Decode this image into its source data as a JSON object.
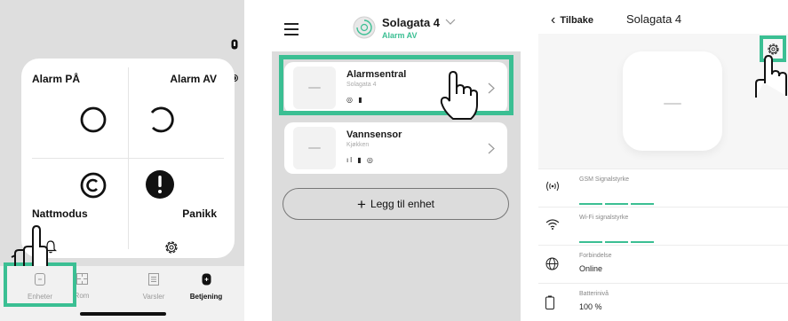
{
  "panel1": {
    "alarm_on": "Alarm PÅ",
    "alarm_off": "Alarm AV",
    "night_mode": "Nattmodus",
    "panic": "Panikk",
    "tabs": [
      {
        "label": "Enheter",
        "icon": "devices-icon"
      },
      {
        "label": "Rom",
        "icon": "rooms-icon"
      },
      {
        "label": "Varsler",
        "icon": "notifications-icon"
      },
      {
        "label": "Betjening",
        "icon": "control-icon"
      }
    ],
    "active_tab": "Betjening"
  },
  "panel2": {
    "hub_name": "Solagata 4",
    "hub_status": "Alarm AV",
    "devices": [
      {
        "name": "Alarmsentral",
        "room": "Solagata 4",
        "status_icons": "◎ ▮"
      },
      {
        "name": "Vannsensor",
        "room": "Kjøkken",
        "status_icons": "ıl ▮ ◎"
      }
    ],
    "add_button": "Legg til enhet"
  },
  "panel3": {
    "back_label": "Tilbake",
    "title": "Solagata 4",
    "rows": [
      {
        "label": "GSM Signalstyrke",
        "value": "",
        "icon": "antenna-icon"
      },
      {
        "label": "Wi-Fi signalstyrke",
        "value": "",
        "icon": "wifi-icon"
      },
      {
        "label": "Forbindelse",
        "value": "Online",
        "icon": "globe-icon"
      },
      {
        "label": "Batterinivå",
        "value": "100 %",
        "icon": "battery-icon"
      }
    ]
  },
  "colors": {
    "accent": "#3bbf93"
  }
}
